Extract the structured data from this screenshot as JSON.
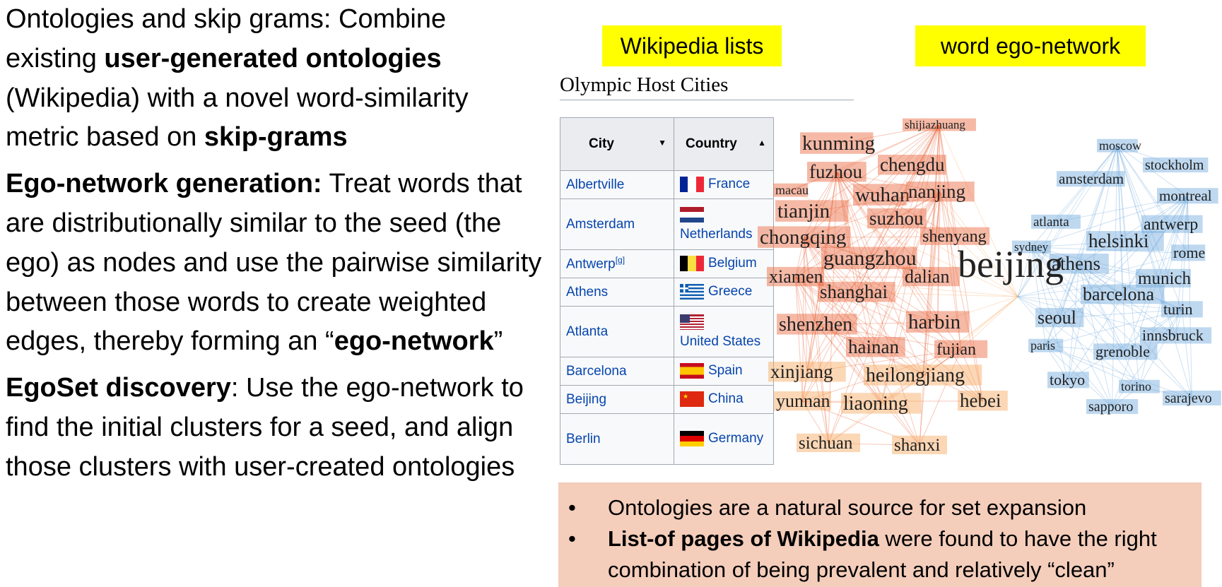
{
  "left_text": {
    "p1": {
      "pre": "Ontologies and skip grams:  Combine existing ",
      "b1": "user-generated ontologies",
      "mid": " (Wikipedia) with a novel word-similarity metric based on ",
      "b2": "skip-grams"
    },
    "p2": {
      "b1": "Ego-network generation:",
      "mid": "  Treat words that are distributionally similar to the seed (the ego) as nodes and use the pairwise similarity between those words to create weighted edges, thereby forming an “",
      "b2": "ego-network",
      "post": "”"
    },
    "p3": {
      "b1": "EgoSet discovery",
      "mid": ": Use the ego-network to find the initial clusters for a seed, and align those clusters with user-created ontologies"
    }
  },
  "tags": {
    "wiki": "Wikipedia lists",
    "ego": "word ego-network"
  },
  "wiki": {
    "title": "Olympic Host Cities",
    "headers": {
      "city": "City",
      "country": "Country"
    },
    "rows": [
      {
        "city": "Albertville",
        "country": "France",
        "flag": "france"
      },
      {
        "city": "Amsterdam",
        "country": "Netherlands",
        "flag": "netherlands"
      },
      {
        "city": "Antwerp",
        "sup": "[g]",
        "country": "Belgium",
        "flag": "belgium"
      },
      {
        "city": "Athens",
        "country": "Greece",
        "flag": "greece"
      },
      {
        "city": "Atlanta",
        "country": "United States",
        "flag": "usa"
      },
      {
        "city": "Barcelona",
        "country": "Spain",
        "flag": "spain"
      },
      {
        "city": "Beijing",
        "country": "China",
        "flag": "china"
      },
      {
        "city": "Berlin",
        "country": "Germany",
        "flag": "germany"
      }
    ]
  },
  "ego_network": {
    "ego": "beijing",
    "red_words": [
      "shijiazhuang",
      "kunming",
      "chengdu",
      "fuzhou",
      "macau",
      "wuhan",
      "nanjing",
      "tianjin",
      "suzhou",
      "chongqing",
      "shenyang",
      "guangzhou",
      "xiamen",
      "dalian",
      "shanghai",
      "shenzhen",
      "harbin",
      "hainan",
      "fujian",
      "xinjiang",
      "heilongjiang",
      "yunnan",
      "liaoning",
      "hebei",
      "sichuan",
      "shanxi"
    ],
    "blue_words": [
      "moscow",
      "stockholm",
      "amsterdam",
      "montreal",
      "atlanta",
      "antwerp",
      "sydney",
      "helsinki",
      "rome",
      "athens",
      "munich",
      "barcelona",
      "turin",
      "seoul",
      "innsbruck",
      "paris",
      "grenoble",
      "tokyo",
      "torino",
      "sarajevo",
      "sapporo"
    ],
    "colors": {
      "red": "#e8643a",
      "orange": "#f7a65a",
      "blue": "#6fa8dc"
    }
  },
  "callout": {
    "b1": "Ontologies are a natural source for set expansion",
    "b2_bold": "List-of pages of Wikipedia",
    "b2_rest": " were found to have the right combination of being prevalent and relatively “clean”",
    "bullet": "•"
  }
}
